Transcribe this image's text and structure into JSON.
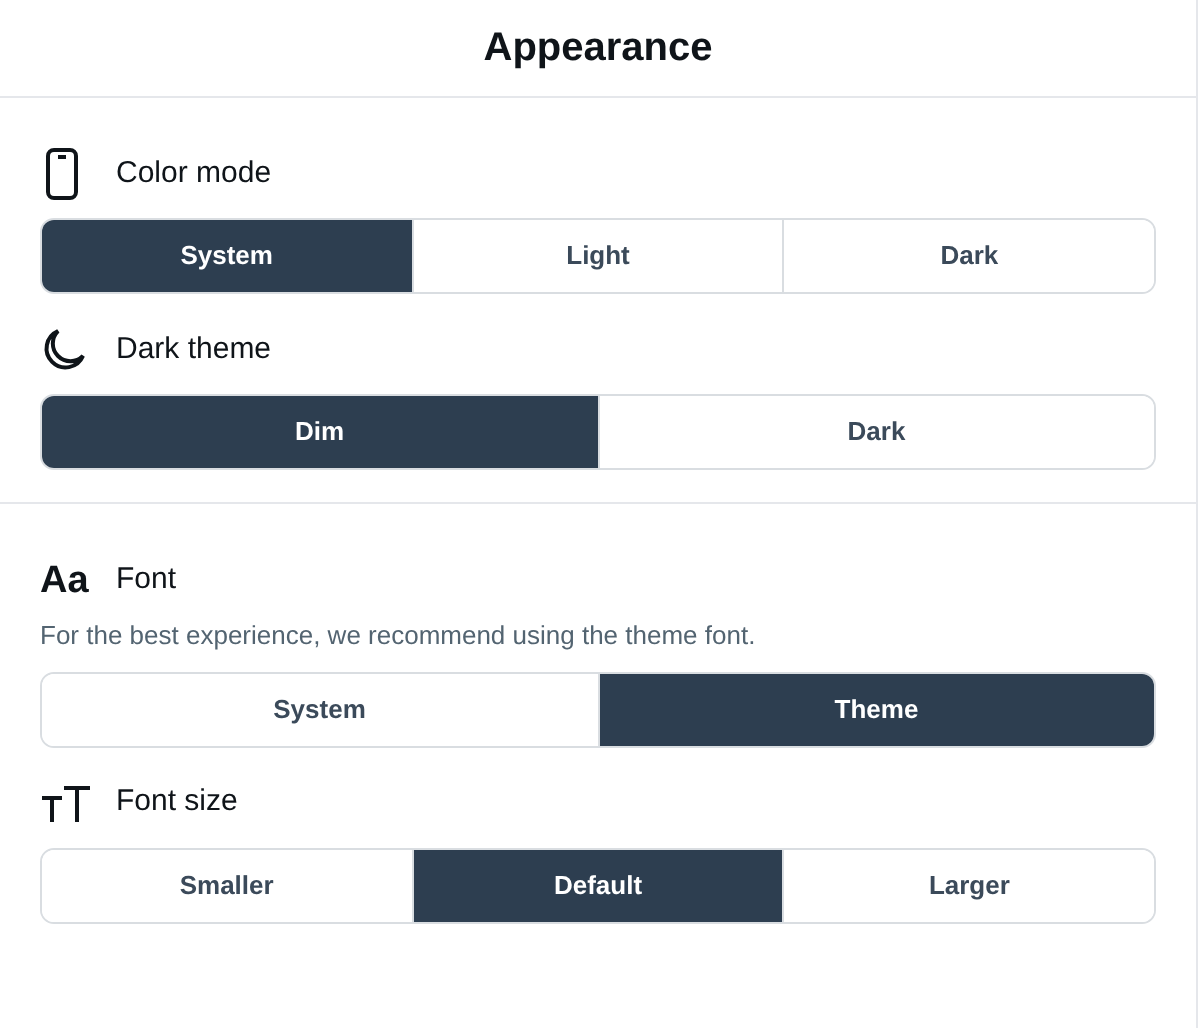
{
  "header": {
    "title": "Appearance"
  },
  "groups": [
    {
      "settings": [
        {
          "kind": "phone",
          "label": "Color mode",
          "options": [
            {
              "label": "System",
              "selected": true
            },
            {
              "label": "Light",
              "selected": false
            },
            {
              "label": "Dark",
              "selected": false
            }
          ]
        },
        {
          "kind": "moon",
          "label": "Dark theme",
          "options": [
            {
              "label": "Dim",
              "selected": true
            },
            {
              "label": "Dark",
              "selected": false
            }
          ]
        }
      ]
    },
    {
      "settings": [
        {
          "kind": "font",
          "icon_text": "Aa",
          "label": "Font",
          "description": "For the best experience, we recommend using the theme font.",
          "options": [
            {
              "label": "System",
              "selected": false
            },
            {
              "label": "Theme",
              "selected": true
            }
          ]
        },
        {
          "kind": "fontsize",
          "label": "Font size",
          "options": [
            {
              "label": "Smaller",
              "selected": false
            },
            {
              "label": "Default",
              "selected": true
            },
            {
              "label": "Larger",
              "selected": false
            }
          ]
        }
      ]
    }
  ]
}
